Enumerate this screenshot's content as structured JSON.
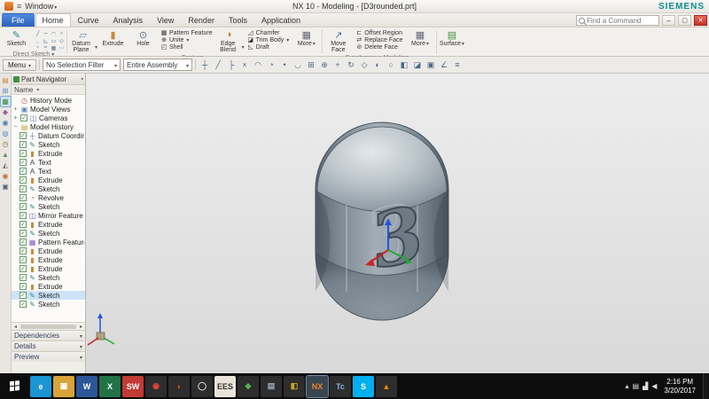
{
  "titlebar": {
    "window_menu": "Window",
    "title": "NX 10 - Modeling - [D3rounded.prt]",
    "brand": "SIEMENS"
  },
  "tabs": [
    {
      "label": "File",
      "kind": "tab-file"
    },
    {
      "label": "Home",
      "kind": "tab-active"
    },
    {
      "label": "Curve"
    },
    {
      "label": "Analysis"
    },
    {
      "label": "View"
    },
    {
      "label": "Render"
    },
    {
      "label": "Tools"
    },
    {
      "label": "Application"
    }
  ],
  "find_command": {
    "placeholder": "Find a Command"
  },
  "ribbon": {
    "sketch": "Sketch",
    "direct_sketch_label": "Direct Sketch",
    "direct_sketch_icons": [
      {
        "name": "profile-icon",
        "glyph": "╱"
      },
      {
        "name": "line-icon",
        "glyph": "─"
      },
      {
        "name": "arc-icon",
        "glyph": "◠"
      },
      {
        "name": "circle-icon",
        "glyph": "○"
      },
      {
        "name": "fillet-icon",
        "glyph": "◟"
      },
      {
        "name": "chamfer-icon",
        "glyph": "◺"
      },
      {
        "name": "rectangle-icon",
        "glyph": "▭"
      },
      {
        "name": "polygon-icon",
        "glyph": "◇"
      },
      {
        "name": "spline-icon",
        "glyph": "~"
      },
      {
        "name": "offset-curve-icon",
        "glyph": "≈"
      },
      {
        "name": "pattern-curve-icon",
        "glyph": "▦"
      },
      {
        "name": "more-curve-icon",
        "glyph": "⋯"
      }
    ],
    "datum_plane": "Datum Plane",
    "extrude": "Extrude",
    "hole": "Hole",
    "pattern_feature": "Pattern Feature",
    "unite": "Unite",
    "shell": "Shell",
    "feature_label": "Feature",
    "edge_blend": "Edge Blend",
    "chamfer": "Chamfer",
    "trim_body": "Trim Body",
    "draft": "Draft",
    "more_feature": "More",
    "move_face": "Move Face",
    "offset_region": "Offset Region",
    "replace_face": "Replace Face",
    "delete_face": "Delete Face",
    "more_sync": "More",
    "sync_label": "Synchronous Modeling",
    "surface": "Surface"
  },
  "toolbar": {
    "menu": "Menu",
    "selection_filter": "No Selection Filter",
    "scope": "Entire Assembly",
    "icons": [
      {
        "name": "snap-point-icon",
        "glyph": "┼"
      },
      {
        "name": "endpoint-icon",
        "glyph": "╱"
      },
      {
        "name": "midpoint-icon",
        "glyph": "├"
      },
      {
        "name": "intersection-icon",
        "glyph": "×"
      },
      {
        "name": "arc-center-icon",
        "glyph": "◠"
      },
      {
        "name": "quadrant-point-icon",
        "glyph": "◔"
      },
      {
        "name": "existing-point-icon",
        "glyph": "•"
      },
      {
        "name": "tangent-point-icon",
        "glyph": "◡"
      },
      {
        "name": "fit-view-icon",
        "glyph": "⊞"
      },
      {
        "name": "zoom-in-icon",
        "glyph": "⊕"
      },
      {
        "name": "pan-view-icon",
        "glyph": "+"
      },
      {
        "name": "rotate-view-icon",
        "glyph": "↻"
      },
      {
        "name": "orient-view-icon",
        "glyph": "◇"
      },
      {
        "name": "shaded-display-icon",
        "glyph": "◐"
      },
      {
        "name": "wireframe-display-icon",
        "glyph": "○"
      },
      {
        "name": "show-hide-icon",
        "glyph": "◧"
      },
      {
        "name": "edit-section-icon",
        "glyph": "◪"
      },
      {
        "name": "window-cascade-icon",
        "glyph": "▣"
      },
      {
        "name": "measure-distance-icon",
        "glyph": "∠"
      },
      {
        "name": "part-settings-icon",
        "glyph": "≡"
      }
    ]
  },
  "resource_bar": {
    "icons": [
      {
        "name": "assembly-navigator-icon",
        "glyph": "▤",
        "color": "#c78a3b"
      },
      {
        "name": "constraint-navigator-icon",
        "glyph": "⊞",
        "color": "#5b84c4"
      },
      {
        "name": "part-navigator-icon",
        "glyph": "▦",
        "color": "#3f8f3f",
        "state": "active"
      },
      {
        "name": "reuse-library-icon",
        "glyph": "◆",
        "color": "#a05ba0"
      },
      {
        "name": "hd3d-tools-icon",
        "glyph": "◉",
        "color": "#3f7fbf"
      },
      {
        "name": "web-browser-icon",
        "glyph": "◎",
        "color": "#2f6fb2"
      },
      {
        "name": "history-icon",
        "glyph": "◷",
        "color": "#8a6f3f"
      },
      {
        "name": "process-studio-icon",
        "glyph": "▲",
        "color": "#5f8f5f"
      },
      {
        "name": "manufacturing-wizard-icon",
        "glyph": "◭",
        "color": "#777777"
      },
      {
        "name": "roles-icon",
        "glyph": "◉",
        "color": "#c2703f"
      },
      {
        "name": "system-scenes-icon",
        "glyph": "▣",
        "color": "#556677"
      }
    ]
  },
  "part_navigator": {
    "title": "Part Navigator",
    "name_column": "Name",
    "root_items": [
      {
        "label": "History Mode",
        "glyph": "◷",
        "color": "#b05050",
        "expand": ""
      },
      {
        "label": "Model Views",
        "glyph": "▣",
        "color": "#5b84c4",
        "expand": "+"
      },
      {
        "label": "Cameras",
        "glyph": "◫",
        "color": "#5b84c4",
        "expand": "+",
        "state": "checked"
      },
      {
        "label": "Model History",
        "glyph": "▤",
        "color": "#c7a33b",
        "expand": "−"
      }
    ],
    "history_items": [
      {
        "label": "Datum Coordinate",
        "glyph": "┼",
        "color": "#5b84c4"
      },
      {
        "label": "Sketch",
        "glyph": "✎",
        "color": "#2e8b8b"
      },
      {
        "label": "Extrude",
        "glyph": "▮",
        "color": "#c78a3b"
      },
      {
        "label": "Text",
        "glyph": "A",
        "color": "#444444"
      },
      {
        "label": "Text",
        "glyph": "A",
        "color": "#444444"
      },
      {
        "label": "Extrude",
        "glyph": "▮",
        "color": "#c78a3b"
      },
      {
        "label": "Sketch",
        "glyph": "✎",
        "color": "#2e8b8b"
      },
      {
        "label": "Revolve",
        "glyph": "◔",
        "color": "#c7603b"
      },
      {
        "label": "Sketch",
        "glyph": "✎",
        "color": "#2e8b8b"
      },
      {
        "label": "Mirror Feature",
        "glyph": "◫",
        "color": "#6a5bc4"
      },
      {
        "label": "Extrude",
        "glyph": "▮",
        "color": "#c78a3b"
      },
      {
        "label": "Sketch",
        "glyph": "✎",
        "color": "#2e8b8b"
      },
      {
        "label": "Pattern Feature",
        "glyph": "▦",
        "color": "#8a5bc4"
      },
      {
        "label": "Extrude",
        "glyph": "▮",
        "color": "#c78a3b"
      },
      {
        "label": "Extrude",
        "glyph": "▮",
        "color": "#c78a3b"
      },
      {
        "label": "Extrude",
        "glyph": "▮",
        "color": "#c78a3b"
      },
      {
        "label": "Sketch",
        "glyph": "✎",
        "color": "#2e8b8b"
      },
      {
        "label": "Extrude",
        "glyph": "▮",
        "color": "#c78a3b"
      },
      {
        "label": "Sketch",
        "glyph": "✎",
        "color": "#2e8b8b",
        "state": "selected"
      },
      {
        "label": "Sketch",
        "glyph": "✎",
        "color": "#2e8b8b"
      }
    ],
    "sections": [
      {
        "label": "Dependencies"
      },
      {
        "label": "Details"
      },
      {
        "label": "Preview"
      }
    ]
  },
  "viewport": {
    "digit": "3"
  },
  "taskbar": {
    "apps": [
      {
        "name": "internet-explorer-icon",
        "glyph": "e",
        "bg": "#1b95d4",
        "fg": "#ffffff"
      },
      {
        "name": "file-explorer-icon",
        "glyph": "▣",
        "bg": "#d8a33a",
        "fg": "#ffffff"
      },
      {
        "name": "word-icon",
        "glyph": "W",
        "bg": "#2b579a",
        "fg": "#ffffff"
      },
      {
        "name": "excel-icon",
        "glyph": "X",
        "bg": "#217346",
        "fg": "#ffffff"
      },
      {
        "name": "solidworks-icon",
        "glyph": "SW",
        "bg": "#c23b34",
        "fg": "#ffffff"
      },
      {
        "name": "chrome-icon",
        "glyph": "◉",
        "bg": "#2d2d2d",
        "fg": "#e8453c"
      },
      {
        "name": "firefox-icon",
        "glyph": "◗",
        "bg": "#2d2d2d",
        "fg": "#e66000"
      },
      {
        "name": "media-player-icon",
        "glyph": "◯",
        "bg": "#2d2d2d",
        "fg": "#dddddd"
      },
      {
        "name": "ees-icon",
        "glyph": "EES",
        "bg": "#e9e4da",
        "fg": "#333333"
      },
      {
        "name": "creo-icon",
        "glyph": "◆",
        "bg": "#2d2d2d",
        "fg": "#59b04f"
      },
      {
        "name": "notepad-icon",
        "glyph": "▤",
        "bg": "#2d2d2d",
        "fg": "#99aabb"
      },
      {
        "name": "cube-viewer-icon",
        "glyph": "◧",
        "bg": "#2d2d2d",
        "fg": "#c9a227"
      },
      {
        "name": "nx-icon",
        "glyph": "NX",
        "bg": "#3a464f",
        "fg": "#f08030",
        "state": "active"
      },
      {
        "name": "teamcenter-icon",
        "glyph": "Tc",
        "bg": "#2d2d2d",
        "fg": "#7fb2e5"
      },
      {
        "name": "skype-icon",
        "glyph": "S",
        "bg": "#00aff0",
        "fg": "#ffffff"
      },
      {
        "name": "vlc-icon",
        "glyph": "▲",
        "bg": "#2d2d2d",
        "fg": "#ff8800"
      }
    ],
    "tray_icons": [
      {
        "name": "show-hidden-icons-icon",
        "glyph": "▴"
      },
      {
        "name": "action-center-icon",
        "glyph": "▤"
      },
      {
        "name": "network-icon",
        "glyph": "▟"
      },
      {
        "name": "volume-icon",
        "glyph": "◀"
      }
    ],
    "time": "2:16 PM",
    "date": "3/20/2017"
  }
}
